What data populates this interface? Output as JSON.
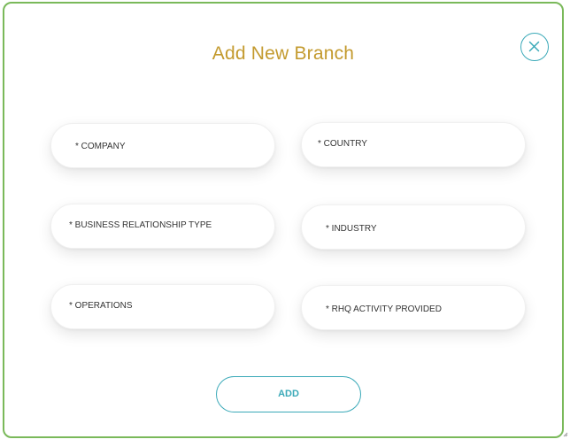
{
  "dialog": {
    "title": "Add New Branch",
    "close_icon": "close-circle-icon"
  },
  "form": {
    "fields": [
      {
        "id": "company",
        "placeholder": "* COMPANY",
        "value": ""
      },
      {
        "id": "country",
        "placeholder": "* COUNTRY",
        "value": ""
      },
      {
        "id": "business_relationship_type",
        "placeholder": "* BUSINESS RELATIONSHIP TYPE",
        "value": ""
      },
      {
        "id": "industry",
        "placeholder": "* INDUSTRY",
        "value": ""
      },
      {
        "id": "operations",
        "placeholder": "* OPERATIONS",
        "value": ""
      },
      {
        "id": "rhq_activity_provided",
        "placeholder": "* RHQ ACTIVITY PROVIDED",
        "value": ""
      }
    ],
    "submit_label": "ADD"
  },
  "colors": {
    "border": "#7ab95a",
    "title": "#c39a2e",
    "accent": "#3aa9b8"
  }
}
